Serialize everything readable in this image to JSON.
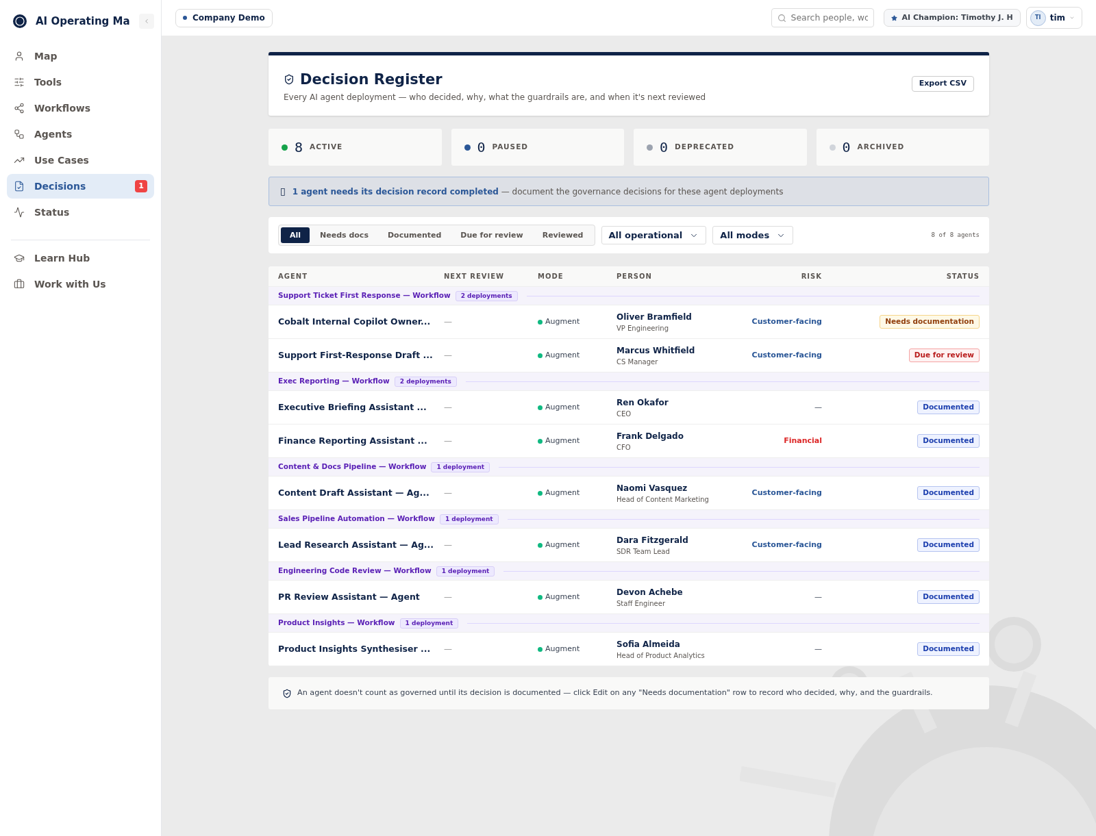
{
  "sidebar": {
    "title": "AI Operating Ma",
    "items": [
      {
        "label": "Map",
        "kind": "person",
        "selected": false
      },
      {
        "label": "Tools",
        "kind": "sliders",
        "selected": false
      },
      {
        "label": "Workflows",
        "kind": "share",
        "selected": false
      },
      {
        "label": "Agents",
        "kind": "agent",
        "selected": false
      },
      {
        "label": "Use Cases",
        "kind": "trend",
        "selected": false
      },
      {
        "label": "Decisions",
        "kind": "doc",
        "selected": true,
        "badge": "1"
      },
      {
        "label": "Status",
        "kind": "pulse",
        "selected": false
      }
    ],
    "footer_items": [
      {
        "label": "Learn Hub",
        "kind": "cap"
      },
      {
        "label": "Work with Us",
        "kind": "briefcase"
      }
    ]
  },
  "topbar": {
    "workspace": "Company Demo",
    "search": {
      "placeholder": "Search people, wo"
    },
    "champion": "AI Champion: Timothy J. H",
    "user": {
      "initials": "TI",
      "name": "tim"
    }
  },
  "header": {
    "title": "Decision Register",
    "subtitle": "Every AI agent deployment — who decided, why, what the guardrails are, and when it's next reviewed",
    "export": "Export CSV"
  },
  "stats": [
    {
      "count": "8",
      "label": "ACTIVE",
      "color": "#16a34a"
    },
    {
      "count": "0",
      "label": "PAUSED",
      "color": "#2b5797"
    },
    {
      "count": "0",
      "label": "DEPRECATED",
      "color": "#9ca3af"
    },
    {
      "count": "0",
      "label": "ARCHIVED",
      "color": "#d1d5db"
    }
  ],
  "alert": {
    "icon": "▯",
    "highlight": "1 agent needs its decision record completed",
    "text": "— document the governance decisions for these agent deployments"
  },
  "filters": {
    "tabs": [
      {
        "label": "All",
        "selected": true
      },
      {
        "label": "Needs docs",
        "selected": false
      },
      {
        "label": "Documented",
        "selected": false
      },
      {
        "label": "Due for review",
        "selected": false
      },
      {
        "label": "Reviewed",
        "selected": false
      }
    ],
    "dropdowns": [
      "All operational",
      "All modes"
    ],
    "count": "8 of 8 agents"
  },
  "table": {
    "columns": [
      "AGENT",
      "NEXT REVIEW",
      "MODE",
      "PERSON",
      "RISK",
      "STATUS"
    ],
    "groups": [
      {
        "name": "Support Ticket First Response — Workflow",
        "count": "2 deployments",
        "rows": [
          {
            "agent": "Cobalt Internal Copilot Owner...",
            "next_review": "—",
            "mode": "Augment",
            "person": "Oliver Bramfield",
            "role": "VP Engineering",
            "risk": {
              "text": "Customer-facing",
              "kind": "customer"
            },
            "status": {
              "text": "Needs documentation",
              "kind": "needs_docs"
            }
          },
          {
            "agent": "Support First-Response Draft ...",
            "next_review": "—",
            "mode": "Augment",
            "person": "Marcus Whitfield",
            "role": "CS Manager",
            "risk": {
              "text": "Customer-facing",
              "kind": "customer"
            },
            "status": {
              "text": "Due for review",
              "kind": "due"
            }
          }
        ]
      },
      {
        "name": "Exec Reporting — Workflow",
        "count": "2 deployments",
        "rows": [
          {
            "agent": "Executive Briefing Assistant ...",
            "next_review": "—",
            "mode": "Augment",
            "person": "Ren Okafor",
            "role": "CEO",
            "risk": {
              "text": "—",
              "kind": "none"
            },
            "status": {
              "text": "Documented",
              "kind": "documented"
            }
          },
          {
            "agent": "Finance Reporting Assistant ...",
            "next_review": "—",
            "mode": "Augment",
            "person": "Frank Delgado",
            "role": "CFO",
            "risk": {
              "text": "Financial",
              "kind": "financial"
            },
            "status": {
              "text": "Documented",
              "kind": "documented"
            }
          }
        ]
      },
      {
        "name": "Content & Docs Pipeline — Workflow",
        "count": "1 deployment",
        "rows": [
          {
            "agent": "Content Draft Assistant — Ag...",
            "next_review": "—",
            "mode": "Augment",
            "person": "Naomi Vasquez",
            "role": "Head of Content Marketing",
            "risk": {
              "text": "Customer-facing",
              "kind": "customer"
            },
            "status": {
              "text": "Documented",
              "kind": "documented"
            }
          }
        ]
      },
      {
        "name": "Sales Pipeline Automation — Workflow",
        "count": "1 deployment",
        "rows": [
          {
            "agent": "Lead Research Assistant — Ag...",
            "next_review": "—",
            "mode": "Augment",
            "person": "Dara Fitzgerald",
            "role": "SDR Team Lead",
            "risk": {
              "text": "Customer-facing",
              "kind": "customer"
            },
            "status": {
              "text": "Documented",
              "kind": "documented"
            }
          }
        ]
      },
      {
        "name": "Engineering Code Review — Workflow",
        "count": "1 deployment",
        "rows": [
          {
            "agent": "PR Review Assistant — Agent",
            "next_review": "—",
            "mode": "Augment",
            "person": "Devon Achebe",
            "role": "Staff Engineer",
            "risk": {
              "text": "—",
              "kind": "none"
            },
            "status": {
              "text": "Documented",
              "kind": "documented"
            }
          }
        ]
      },
      {
        "name": "Product Insights — Workflow",
        "count": "1 deployment",
        "rows": [
          {
            "agent": "Product Insights Synthesiser ...",
            "next_review": "—",
            "mode": "Augment",
            "person": "Sofia Almeida",
            "role": "Head of Product Analytics",
            "risk": {
              "text": "—",
              "kind": "none"
            },
            "status": {
              "text": "Documented",
              "kind": "documented"
            }
          }
        ]
      }
    ]
  },
  "footer_note": "An agent doesn't count as governed until its decision is documented — click Edit on any \"Needs documentation\" row to record who decided, why, and the guardrails."
}
